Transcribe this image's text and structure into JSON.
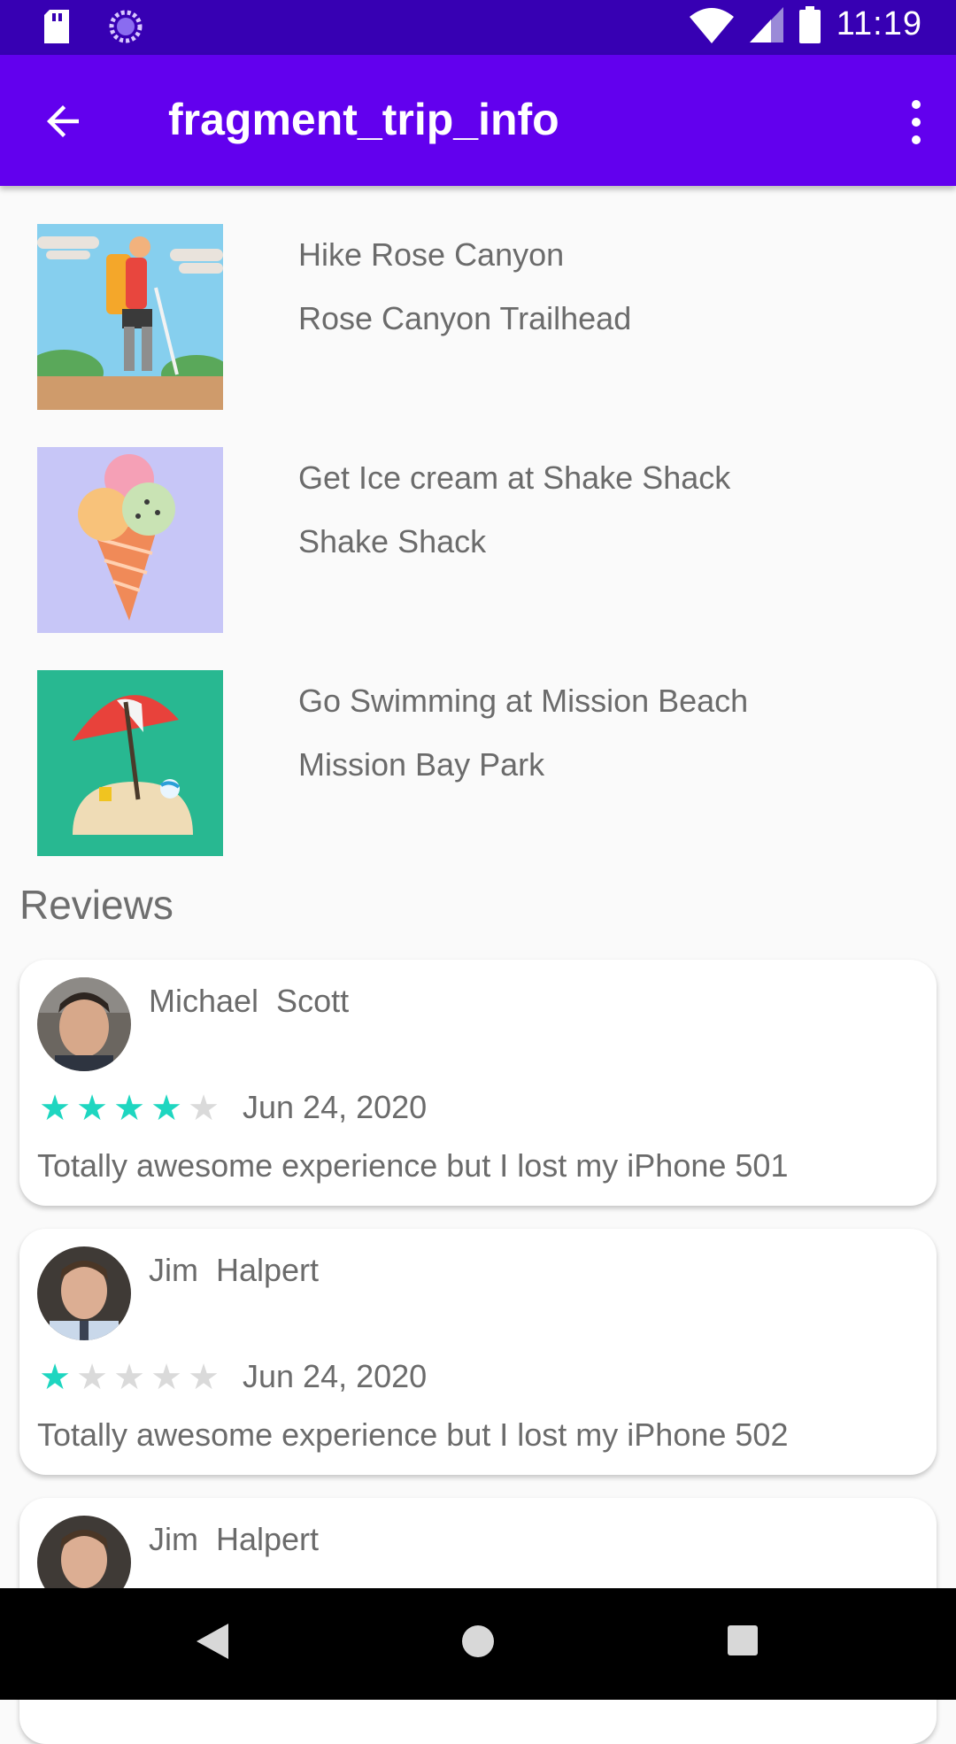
{
  "status_bar": {
    "time": "11:19",
    "icons": [
      "sd-card-icon",
      "sync-icon",
      "wifi-icon",
      "cell-signal-icon",
      "battery-icon"
    ]
  },
  "app_bar": {
    "title": "fragment_trip_info",
    "icons": [
      "back-arrow-icon",
      "overflow-menu-icon"
    ]
  },
  "activities": [
    {
      "name": "Hike Rose Canyon",
      "place": "Rose Canyon Trailhead",
      "image_icon": "hiker-icon"
    },
    {
      "name": "Get Ice cream at Shake Shack",
      "place": "Shake Shack",
      "image_icon": "ice-cream-icon"
    },
    {
      "name": "Go Swimming at Mission Beach",
      "place": "Mission Bay Park",
      "image_icon": "beach-umbrella-icon"
    }
  ],
  "reviews_heading": "Reviews",
  "reviews": [
    {
      "reviewer": "Michael  Scott",
      "rating": 4,
      "max_rating": 5,
      "date": "Jun 24, 2020",
      "text": "Totally awesome experience but I lost my iPhone 501"
    },
    {
      "reviewer": "Jim  Halpert",
      "rating": 1,
      "max_rating": 5,
      "date": "Jun 24, 2020",
      "text": "Totally awesome experience but I lost my iPhone 502"
    },
    {
      "reviewer": "Jim  Halpert"
    }
  ],
  "colors": {
    "status_bar": "#3700b3",
    "app_bar": "#6200ee",
    "star_filled": "#1ed6c0",
    "star_empty": "#dadada"
  },
  "nav_bar": {
    "icons": [
      "back-triangle-icon",
      "home-circle-icon",
      "recents-square-icon"
    ]
  }
}
